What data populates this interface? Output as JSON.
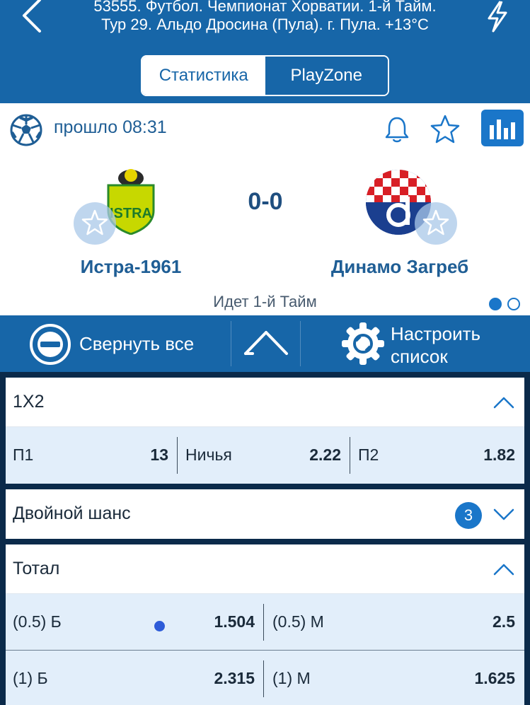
{
  "header": {
    "title_line1": "53555. Футбол. Чемпионат Хорватии. 1-й Тайм.",
    "title_line2": "Тур 29. Альдо Дросина (Пула). г. Пула. +13°C",
    "tabs": [
      "Статистика",
      "PlayZone"
    ],
    "active_tab": "Статистика"
  },
  "match": {
    "elapsed": "прошло 08:31",
    "score": "0-0",
    "home_team": "Истра-1961",
    "away_team": "Динамо Загреб",
    "period": "Идет 1-й  Тайм",
    "home_logo_text": "ISTRA",
    "page_dots": 2,
    "active_dot": 1
  },
  "toolbar": {
    "collapse_label": "Свернуть все",
    "config_label_line1": "Настроить",
    "config_label_line2": "список"
  },
  "markets": {
    "m1x2": {
      "title": "1X2",
      "p1_label": "П1",
      "p1_odd": "13",
      "draw_label": "Ничья",
      "draw_odd": "2.22",
      "p2_label": "П2",
      "p2_odd": "1.82"
    },
    "double": {
      "title": "Двойной шанс",
      "badge": "3"
    },
    "total": {
      "title": "Тотал",
      "rows": [
        {
          "over_label": "(0.5) Б",
          "over_odd": "1.504",
          "under_label": "(0.5) М",
          "under_odd": "2.5"
        },
        {
          "over_label": "(1) Б",
          "over_odd": "2.315",
          "under_label": "(1) М",
          "under_odd": "1.625"
        }
      ]
    }
  },
  "colors": {
    "primary": "#1766a8",
    "accent": "#1a76c9",
    "row_bg": "#e2eefa",
    "page_bg": "#0b2a4a"
  }
}
